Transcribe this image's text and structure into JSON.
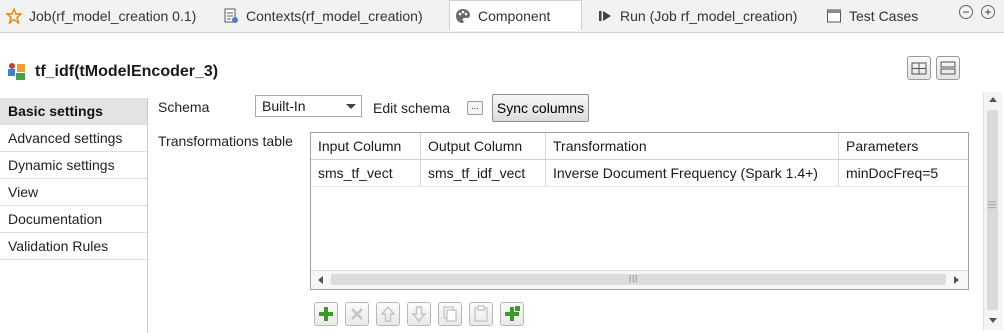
{
  "tabs": [
    {
      "label": "Job(rf_model_creation 0.1)",
      "icon": "job-icon"
    },
    {
      "label": "Contexts(rf_model_creation)",
      "icon": "contexts-icon"
    },
    {
      "label": "Component",
      "icon": "palette-icon",
      "active": true
    },
    {
      "label": "Run (Job rf_model_creation)",
      "icon": "run-icon"
    },
    {
      "label": "Test Cases",
      "icon": "test-cases-icon"
    }
  ],
  "tab_controls": {
    "minimize": "−",
    "maximize": "+"
  },
  "header": {
    "title": "tf_idf(tModelEncoder_3)"
  },
  "left_nav": [
    {
      "label": "Basic settings",
      "active": true
    },
    {
      "label": "Advanced settings"
    },
    {
      "label": "Dynamic settings"
    },
    {
      "label": "View"
    },
    {
      "label": "Documentation"
    },
    {
      "label": "Validation Rules"
    }
  ],
  "schema": {
    "label": "Schema",
    "value": "Built-In",
    "edit_label": "Edit schema",
    "edit_button": "...",
    "sync_button": "Sync columns"
  },
  "transformations": {
    "label": "Transformations table",
    "columns": [
      "Input Column",
      "Output Column",
      "Transformation",
      "Parameters"
    ],
    "rows": [
      [
        "sms_tf_vect",
        "sms_tf_idf_vect",
        "Inverse Document Frequency (Spark 1.4+)",
        "minDocFreq=5"
      ]
    ]
  },
  "toolbar": [
    "add-icon",
    "delete-icon",
    "move-up-icon",
    "move-down-icon",
    "copy-icon",
    "paste-icon",
    "add-all-icon"
  ],
  "colors": {
    "accent_green": "#3c9a2b",
    "active_nav_bg": "#e3e3e3",
    "tab_bg": "#f2f2f2"
  }
}
